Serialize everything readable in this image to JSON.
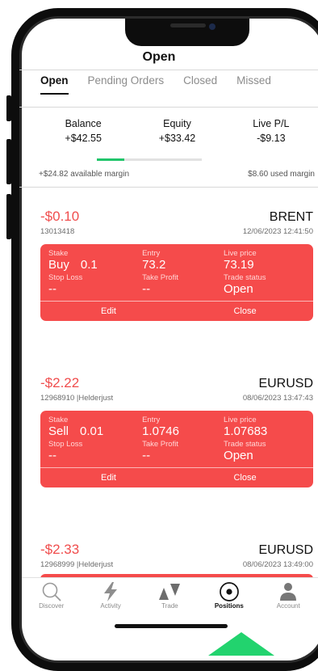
{
  "header": {
    "title": "Open"
  },
  "tabs": [
    {
      "label": "Open",
      "active": true
    },
    {
      "label": "Pending Orders",
      "active": false
    },
    {
      "label": "Closed",
      "active": false
    },
    {
      "label": "Missed",
      "active": false
    }
  ],
  "stats": {
    "balance_label": "Balance",
    "balance_value": "+$42.55",
    "equity_label": "Equity",
    "equity_value": "+$33.42",
    "livepl_label": "Live P/L",
    "livepl_value": "-$9.13"
  },
  "margin": {
    "available": "+$24.82 available margin",
    "used": "$8.60 used margin",
    "used_fraction": 0.26
  },
  "labels": {
    "stake": "Stake",
    "entry": "Entry",
    "live_price": "Live price",
    "stop_loss": "Stop Loss",
    "take_profit": "Take Profit",
    "trade_status": "Trade status",
    "edit": "Edit",
    "close": "Close"
  },
  "trades": [
    {
      "pl": "-$0.10",
      "symbol": "BRENT",
      "id": "13013418",
      "datetime": "12/06/2023 12:41:50",
      "side": "Buy",
      "stake": "0.1",
      "entry": "73.2",
      "live_price": "73.19",
      "stop_loss": "--",
      "take_profit": "--",
      "status": "Open"
    },
    {
      "pl": "-$2.22",
      "symbol": "EURUSD",
      "id": "12968910 |Helderjust",
      "datetime": "08/06/2023 13:47:43",
      "side": "Sell",
      "stake": "0.01",
      "entry": "1.0746",
      "live_price": "1.07683",
      "stop_loss": "--",
      "take_profit": "--",
      "status": "Open"
    },
    {
      "pl": "-$2.33",
      "symbol": "EURUSD",
      "id": "12968999 |Helderjust",
      "datetime": "08/06/2023 13:49:00"
    }
  ],
  "nav": [
    {
      "label": "Discover",
      "icon": "search-icon"
    },
    {
      "label": "Activity",
      "icon": "lightning-icon"
    },
    {
      "label": "Trade",
      "icon": "trade-arrows-icon"
    },
    {
      "label": "Positions",
      "icon": "positions-icon",
      "active": true
    },
    {
      "label": "Account",
      "icon": "person-icon"
    }
  ],
  "colors": {
    "loss": "#f04d4d",
    "card": "#f54b4b",
    "progress": "#21c56b",
    "arrow": "#22d36e"
  }
}
